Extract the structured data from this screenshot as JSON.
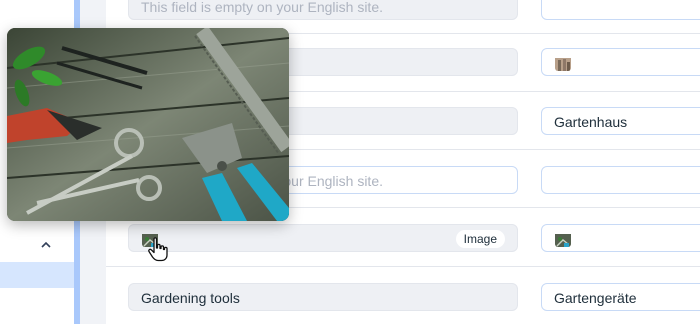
{
  "left_panel": {
    "collapse_icon": "chevron-up-icon",
    "selected_row": "highlighted"
  },
  "rows": [
    {
      "source_placeholder": "This field is empty on your English site.",
      "target_value": ""
    },
    {
      "source_value": "",
      "target_thumbnail": "image-thumbnail-icon"
    },
    {
      "source_value": "",
      "target_value": "Gartenhaus"
    },
    {
      "source_placeholder": "This field is empty on your English site.",
      "target_value": ""
    },
    {
      "source_badge": "Image",
      "source_thumbnail": "image-thumbnail-icon",
      "target_thumbnail": "image-thumbnail-icon"
    },
    {
      "source_value": "Gardening tools",
      "target_value": "Gartengeräte"
    }
  ],
  "popup": {
    "subject": "garden-tools-photo"
  },
  "cursor": "hand-pointer-icon",
  "colors": {
    "accent": "#a9c8fb",
    "selected": "#d6e6fe",
    "field_border": "#c8daf6",
    "readonly_bg": "#eef0f4"
  }
}
